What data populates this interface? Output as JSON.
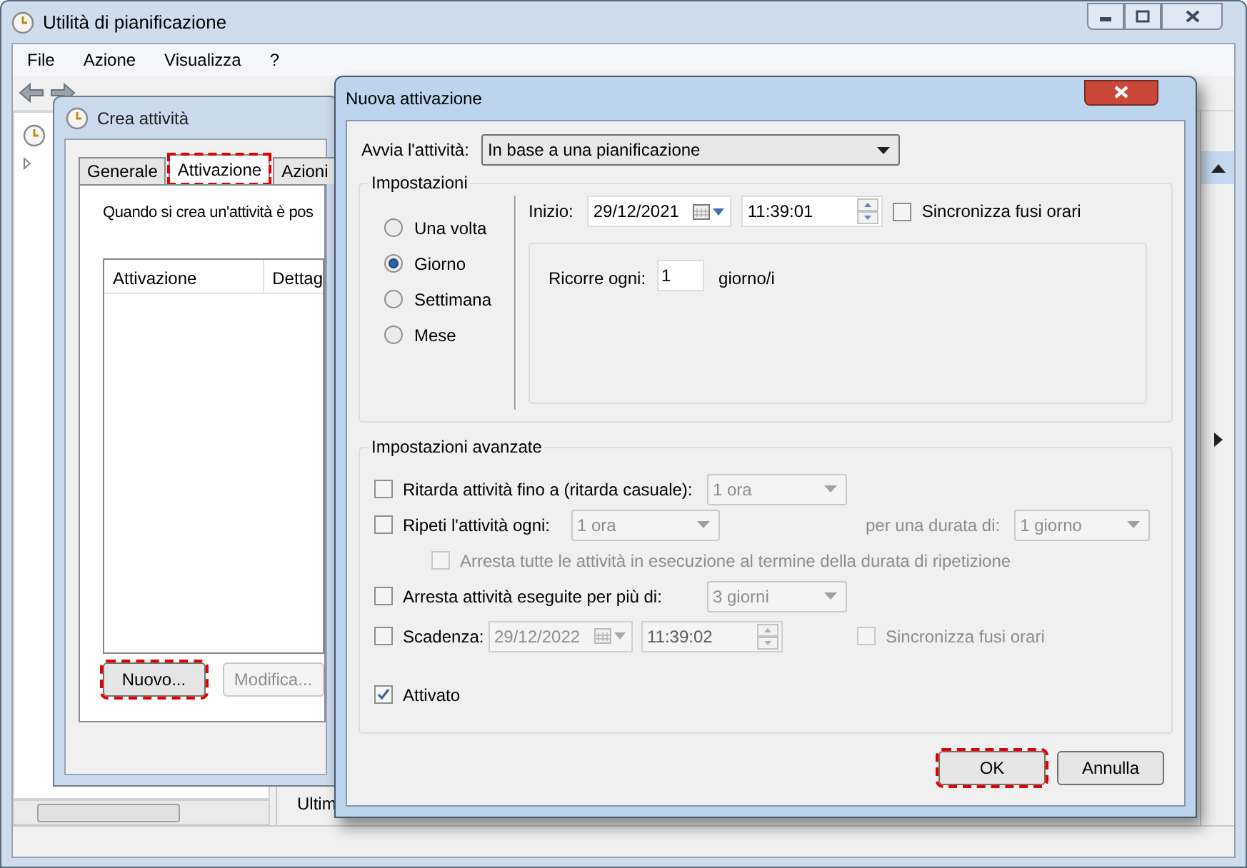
{
  "main_window": {
    "title": "Utilità di pianificazione",
    "menu": [
      "File",
      "Azione",
      "Visualizza",
      "?"
    ],
    "bottom_pane_text": "Ultim"
  },
  "crea_dialog": {
    "title": "Crea attività",
    "tabs": [
      {
        "label": "Generale",
        "selected": false,
        "highlighted": false
      },
      {
        "label": "Attivazione",
        "selected": true,
        "highlighted": true
      },
      {
        "label": "Azioni",
        "selected": false,
        "highlighted": false
      }
    ],
    "description": "Quando si crea un'attività è pos",
    "list_columns": [
      "Attivazione",
      "Dettag"
    ],
    "buttons": [
      {
        "label": "Nuovo...",
        "disabled": false,
        "highlighted": true
      },
      {
        "label": "Modifica...",
        "disabled": true,
        "highlighted": false
      }
    ]
  },
  "nuova_dialog": {
    "title": "Nuova attivazione",
    "start_label": "Avvia l'attività:",
    "start_value": "In base a una pianificazione",
    "settings_group": "Impostazioni",
    "schedule_options": [
      {
        "label": "Una volta",
        "selected": false
      },
      {
        "label": "Giorno",
        "selected": true
      },
      {
        "label": "Settimana",
        "selected": false
      },
      {
        "label": "Mese",
        "selected": false
      }
    ],
    "start": {
      "label": "Inizio:",
      "date": "29/12/2021",
      "time": "11:39:01",
      "sync_label": "Sincronizza fusi orari",
      "sync_checked": false
    },
    "recur": {
      "label": "Ricorre ogni:",
      "value": "1",
      "unit": "giorno/i"
    },
    "advanced_group": "Impostazioni avanzate",
    "advanced": [
      {
        "kind": "dropdown",
        "label": "Ritarda attività fino a (ritarda casuale):",
        "checked": false,
        "value": "1 ora"
      },
      {
        "kind": "repeat",
        "label": "Ripeti l'attività ogni:",
        "checked": false,
        "value": "1 ora",
        "duration_label": "per una durata di:",
        "duration_value": "1 giorno"
      },
      {
        "kind": "sub_check",
        "label": "Arresta tutte le attività in esecuzione al termine della durata di ripetizione",
        "checked": false,
        "disabled": true
      },
      {
        "kind": "dropdown",
        "label": "Arresta attività eseguite per più di:",
        "checked": false,
        "value": "3 giorni"
      },
      {
        "kind": "expiry",
        "label": "Scadenza:",
        "checked": false,
        "date": "29/12/2022",
        "time": "11:39:02",
        "sync_label": "Sincronizza fusi orari",
        "sync_checked": false
      },
      {
        "kind": "check",
        "label": "Attivato",
        "checked": true
      }
    ],
    "buttons": [
      {
        "label": "OK",
        "highlighted": true
      },
      {
        "label": "Annulla",
        "highlighted": false
      }
    ]
  }
}
